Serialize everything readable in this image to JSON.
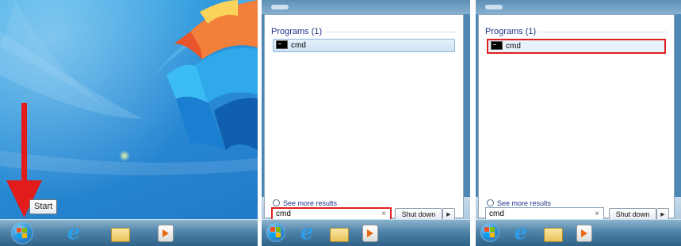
{
  "panel1": {
    "tooltip": "Start",
    "taskbar_icons": [
      "start-orb",
      "internet-explorer-icon",
      "windows-explorer-icon",
      "media-player-icon"
    ]
  },
  "panel2": {
    "group_header": "Programs (1)",
    "result_label": "cmd",
    "see_more": "See more results",
    "search_value": "cmd",
    "clear_glyph": "×",
    "shutdown_label": "Shut down",
    "shutdown_arrow": "▶"
  },
  "panel3": {
    "group_header": "Programs (1)",
    "result_label": "cmd",
    "see_more": "See more results",
    "search_value": "cmd",
    "clear_glyph": "×",
    "shutdown_label": "Shut down",
    "shutdown_arrow": "▶"
  },
  "colors": {
    "highlight_red": "#e02020",
    "desktop_blue": "#2a8ed6",
    "link_blue": "#1e3287"
  }
}
